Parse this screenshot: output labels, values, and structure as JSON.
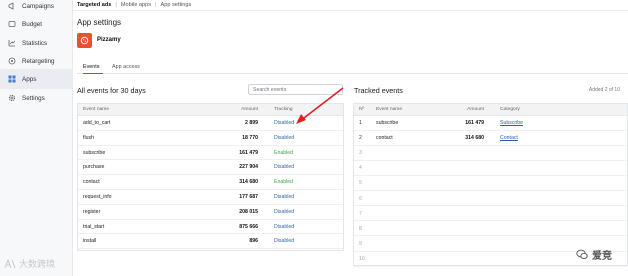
{
  "sidebar": {
    "items": [
      {
        "label": "Campaigns",
        "icon": "campaigns-icon",
        "active": false
      },
      {
        "label": "Budget",
        "icon": "budget-icon",
        "active": false
      },
      {
        "label": "Statistics",
        "icon": "statistics-icon",
        "active": false
      },
      {
        "label": "Retargeting",
        "icon": "retargeting-icon",
        "active": false
      },
      {
        "label": "Apps",
        "icon": "apps-grid-icon",
        "active": true
      },
      {
        "label": "Settings",
        "icon": "gear-icon",
        "active": false
      }
    ]
  },
  "breadcrumb": {
    "items": [
      "Targeted ads",
      "Mobile apps",
      "App settings"
    ]
  },
  "page": {
    "title": "App settings",
    "app_name": "Pizzamy",
    "app_color": "#e8532e"
  },
  "tabs": [
    "Events",
    "App access"
  ],
  "all_events": {
    "title": "All events for 30 days",
    "search_placeholder": "Search events",
    "columns": [
      "Event name",
      "Amount",
      "Tracking"
    ],
    "rows": [
      {
        "name": "add_to_cart",
        "amount": "2 899",
        "tracking": "Disabled"
      },
      {
        "name": "flush",
        "amount": "18 770",
        "tracking": "Disabled"
      },
      {
        "name": "subscribe",
        "amount": "161 479",
        "tracking": "Enabled"
      },
      {
        "name": "purchase",
        "amount": "227 904",
        "tracking": "Disabled"
      },
      {
        "name": "contact",
        "amount": "314 680",
        "tracking": "Enabled"
      },
      {
        "name": "request_info",
        "amount": "177 687",
        "tracking": "Disabled"
      },
      {
        "name": "register",
        "amount": "208 015",
        "tracking": "Disabled"
      },
      {
        "name": "trial_start",
        "amount": "875 666",
        "tracking": "Disabled"
      },
      {
        "name": "install",
        "amount": "896",
        "tracking": "Disabled"
      }
    ]
  },
  "tracked_events": {
    "title": "Tracked events",
    "added": "Added 2 of 10",
    "columns": [
      "Nº",
      "Event name",
      "Amount",
      "Category"
    ],
    "rows": [
      {
        "n": "1",
        "name": "subscribe",
        "amount": "161 479",
        "category": "Subscribe"
      },
      {
        "n": "2",
        "name": "contact",
        "amount": "314 680",
        "category": "Contact"
      },
      {
        "n": "3",
        "name": "",
        "amount": "",
        "category": ""
      },
      {
        "n": "4",
        "name": "",
        "amount": "",
        "category": ""
      },
      {
        "n": "5",
        "name": "",
        "amount": "",
        "category": ""
      },
      {
        "n": "6",
        "name": "",
        "amount": "",
        "category": ""
      },
      {
        "n": "7",
        "name": "",
        "amount": "",
        "category": ""
      },
      {
        "n": "8",
        "name": "",
        "amount": "",
        "category": ""
      },
      {
        "n": "9",
        "name": "",
        "amount": "",
        "category": ""
      },
      {
        "n": "10",
        "name": "",
        "amount": "",
        "category": ""
      }
    ]
  },
  "watermarks": {
    "left": "大数跨境",
    "right": "爱竞"
  },
  "colors": {
    "accent": "#2f6fc9",
    "enabled": "#3aa54b",
    "disabled": "#3366aa",
    "arrow": "#e02020"
  }
}
